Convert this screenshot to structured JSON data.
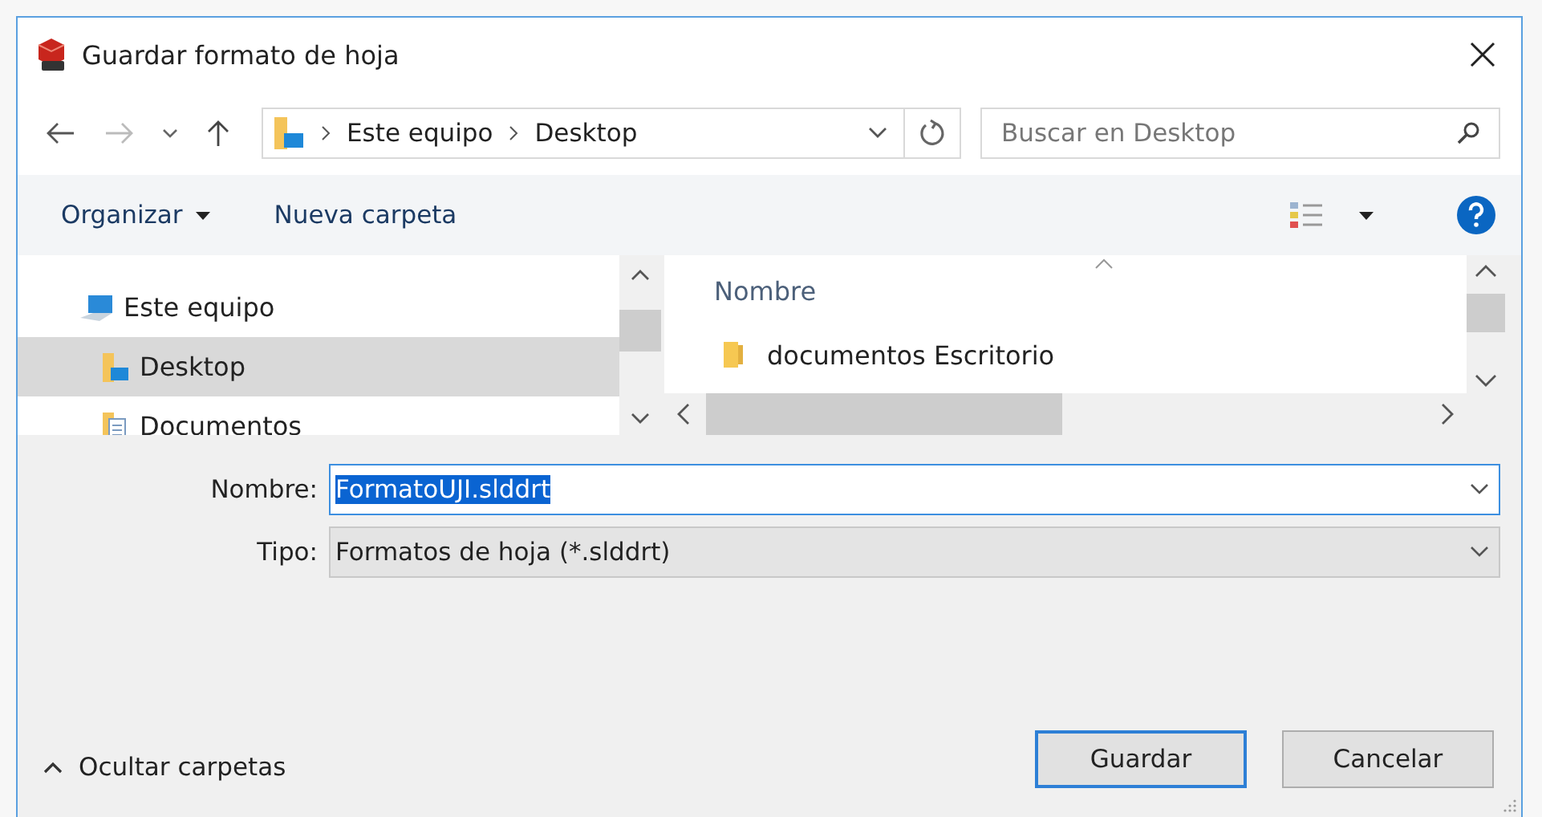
{
  "window": {
    "title": "Guardar formato de hoja"
  },
  "navigation": {
    "breadcrumbs": [
      "Este equipo",
      "Desktop"
    ],
    "search": {
      "placeholder": "Buscar en Desktop"
    }
  },
  "toolbar": {
    "organize": "Organizar",
    "new_folder": "Nueva carpeta"
  },
  "tree": [
    {
      "label": "Este equipo",
      "selected": false,
      "children": [
        {
          "label": "Desktop",
          "selected": true
        },
        {
          "label": "Documentos",
          "selected": false
        }
      ]
    }
  ],
  "file_list": {
    "columns": [
      "Nombre"
    ],
    "rows": [
      {
        "name": "documentos Escritorio"
      }
    ]
  },
  "form": [
    {
      "label": "Nombre:",
      "value": "FormatoUJI.slddrt",
      "kind": "input",
      "text_selected": true
    },
    {
      "label": "Tipo:",
      "value": "Formatos de hoja (*.slddrt)",
      "kind": "select"
    }
  ],
  "footer": {
    "toggle": "Ocultar carpetas",
    "buttons": [
      {
        "label": "Guardar",
        "default": true
      },
      {
        "label": "Cancelar",
        "default": false
      }
    ]
  }
}
